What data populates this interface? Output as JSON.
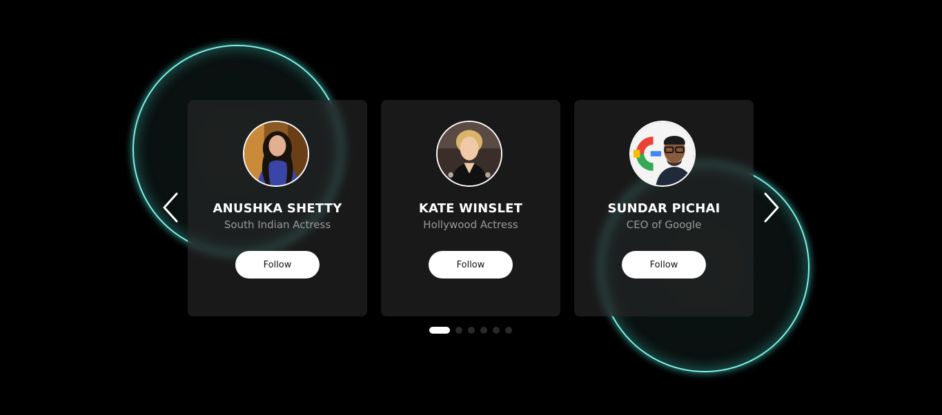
{
  "carousel": {
    "cards": [
      {
        "name": "ANUSHKA SHETTY",
        "role": "South Indian Actress",
        "button_label": "Follow",
        "avatar": "portrait-photo-woman"
      },
      {
        "name": "KATE WINSLET",
        "role": "Hollywood Actress",
        "button_label": "Follow",
        "avatar": "portrait-photo-woman"
      },
      {
        "name": "SUNDAR PICHAI",
        "role": "CEO of Google",
        "button_label": "Follow",
        "avatar": "portrait-photo-man"
      }
    ],
    "prev_icon": "chevron-left-icon",
    "next_icon": "chevron-right-icon",
    "pagination": {
      "total": 6,
      "active_index": 0
    }
  },
  "colors": {
    "background": "#000000",
    "card": "#282828",
    "glow": "#7ff5ea",
    "button": "#ffffff",
    "role_text": "#9a9a9a"
  }
}
